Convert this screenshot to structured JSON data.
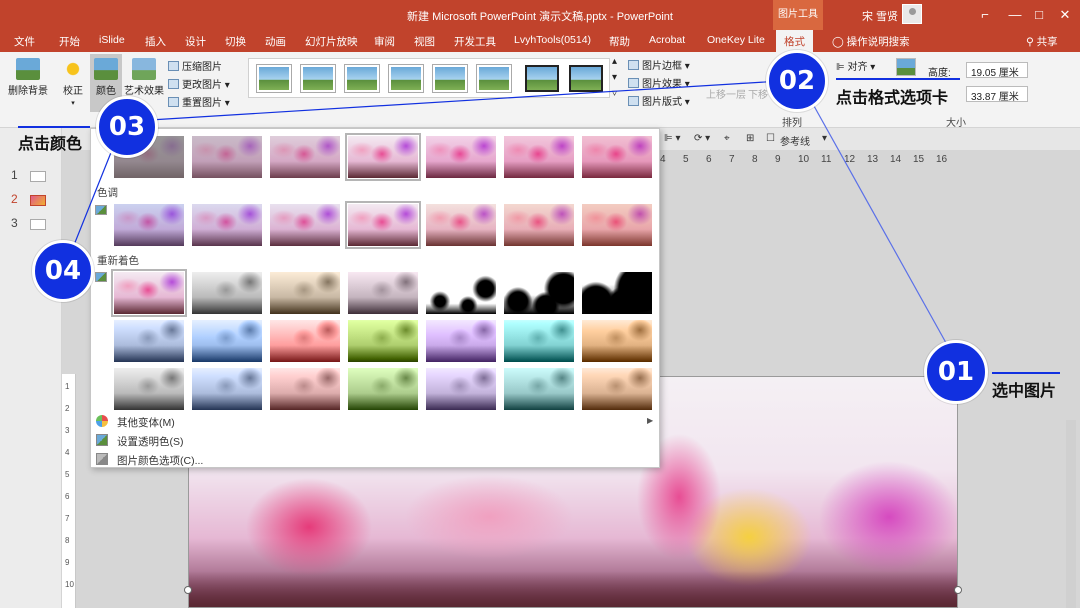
{
  "window": {
    "title": "新建 Microsoft PowerPoint 演示文稿.pptx - PowerPoint",
    "context_tab_label": "图片工具",
    "user_name": "宋 雪贤",
    "minimize_glyph": "—",
    "restore_glyph": "□",
    "close_glyph": "✕",
    "ribbon_options_glyph": "⌐"
  },
  "tabs": [
    {
      "label": "文件"
    },
    {
      "label": "开始"
    },
    {
      "label": "iSlide"
    },
    {
      "label": "插入"
    },
    {
      "label": "设计"
    },
    {
      "label": "切换"
    },
    {
      "label": "动画"
    },
    {
      "label": "幻灯片放映"
    },
    {
      "label": "审阅"
    },
    {
      "label": "视图"
    },
    {
      "label": "开发工具"
    },
    {
      "label": "LvyhTools(0514)"
    },
    {
      "label": "帮助"
    },
    {
      "label": "Acrobat"
    },
    {
      "label": "OneKey Lite"
    },
    {
      "label": "格式"
    }
  ],
  "tell_me": "操作说明搜索",
  "share": "共享",
  "ribbon": {
    "remove_bg": "删除背景",
    "correct": "校正",
    "color": "颜色",
    "artistic": "艺术效果",
    "compress": "压缩图片",
    "change": "更改图片",
    "reset": "重置图片",
    "border": "图片边框",
    "effects": "图片效果",
    "layout": "图片版式",
    "bring_forward": "上移一层",
    "send_backward": "下移",
    "align": "对齐",
    "arrange_label": "排列",
    "height_label": "高度:",
    "height_value": "19.05 厘米",
    "width_value": "33.87 厘米",
    "size_label": "大小"
  },
  "slides": [
    {
      "number": "1"
    },
    {
      "number": "2"
    },
    {
      "number": "3"
    }
  ],
  "guides_label": "参考线",
  "ruler_marks": [
    "4",
    "5",
    "6",
    "7",
    "8",
    "9",
    "10",
    "11",
    "12",
    "13",
    "14",
    "15",
    "16"
  ],
  "vruler_marks": [
    "1",
    "2",
    "3",
    "4",
    "5",
    "6",
    "7",
    "8",
    "9",
    "10"
  ],
  "dropdown": {
    "tone_label": "色调",
    "recolor_label": "重新着色",
    "more_variations": "其他变体(M)",
    "set_transparent": "设置透明色(S)",
    "color_options": "图片颜色选项(C)...",
    "submenu_arrow": "▶",
    "saturation_row": [
      {
        "style": "grayish"
      },
      {
        "style": "muted"
      },
      {
        "style": "semi"
      },
      {
        "style": "normal",
        "selected": true
      },
      {
        "style": "vivid"
      },
      {
        "style": "vivid2"
      },
      {
        "style": "vivid3"
      }
    ],
    "tone_row": [
      {
        "style": "cool"
      },
      {
        "style": "cool2"
      },
      {
        "style": "cool3"
      },
      {
        "style": "normal",
        "selected": true
      },
      {
        "style": "warm"
      },
      {
        "style": "warm2"
      },
      {
        "style": "warm3"
      }
    ],
    "recolor_rows": [
      [
        "#original",
        "#555555",
        "#7a6a55",
        "#f0e0ea",
        "#000000-a",
        "#000000-b",
        "#000000-c"
      ],
      [
        "#2a3a5a",
        "#2a4a7a",
        "#8a2a2a",
        "#6a8a2a",
        "#5a3a7a",
        "#2a7a7a",
        "#8a5a2a"
      ],
      [
        "#c8c8c8",
        "#a8b8d8",
        "#d8a8a8",
        "#b8d898",
        "#c0b0d8",
        "#a8d8d8",
        "#e0b898"
      ]
    ]
  },
  "annotations": {
    "badge1": "01",
    "badge2": "02",
    "badge3": "03",
    "badge4": "04",
    "step1": "选中图片",
    "step2": "点击格式选项卡",
    "step3": "点击颜色"
  },
  "colors": {
    "office_red": "#c1432c",
    "badge_blue": "#1130e0"
  }
}
